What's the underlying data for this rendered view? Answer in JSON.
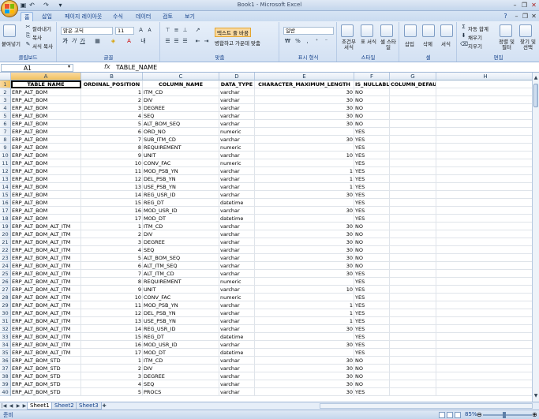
{
  "window": {
    "title": "Book1 - Microsoft Excel"
  },
  "quick_access": {
    "save_icon": "save-icon",
    "undo_icon": "undo-icon",
    "redo_icon": "redo-icon"
  },
  "tabs": [
    "홈",
    "삽입",
    "페이지 레이아웃",
    "수식",
    "데이터",
    "검토",
    "보기"
  ],
  "ribbon": {
    "clipboard": {
      "label": "클립보드",
      "paste": "붙여넣기",
      "cut": "잘라내기",
      "copy": "복사",
      "format_painter": "서식 복사"
    },
    "font": {
      "label": "글꼴",
      "font_name": "맑은 고딕",
      "font_size": "11",
      "bold": "가",
      "italic": "가",
      "underline": "가"
    },
    "alignment": {
      "label": "맞춤",
      "wrap_text": "텍스트 줄 바꿈",
      "merge_center": "병합하고 가운데 맞춤"
    },
    "number": {
      "label": "표시 형식",
      "format": "일반",
      "currency": "₩",
      "percent": "%"
    },
    "styles": {
      "label": "스타일",
      "conditional": "조건부 서식",
      "table_format": "표 서식",
      "cell_style": "셀 스타일"
    },
    "cells": {
      "label": "셀",
      "insert": "삽입",
      "delete": "삭제",
      "format": "서식"
    },
    "editing": {
      "label": "편집",
      "autosum": "자동 합계",
      "fill": "채우기",
      "clear": "지우기",
      "sort_filter": "정렬 및 필터",
      "find_select": "찾기 및 선택"
    }
  },
  "formula_bar": {
    "name_box": "A1",
    "fx": "fx",
    "content": "TABLE_NAME"
  },
  "grid": {
    "columns": [
      "A",
      "B",
      "C",
      "D",
      "E",
      "F",
      "G",
      "H"
    ],
    "header": [
      "TABLE_NAME",
      "ORDINAL_POSITION",
      "COLUMN_NAME",
      "DATA_TYPE",
      "CHARACTER_MAXIMUM_LENGTH",
      "IS_NULLABLE",
      "COLUMN_DEFAULT"
    ],
    "rows": [
      [
        "ERP_ALT_BOM",
        "1",
        "ITM_CD",
        "varchar",
        "30",
        "NO",
        ""
      ],
      [
        "ERP_ALT_BOM",
        "2",
        "DIV",
        "varchar",
        "30",
        "NO",
        ""
      ],
      [
        "ERP_ALT_BOM",
        "3",
        "DEGREE",
        "varchar",
        "30",
        "NO",
        ""
      ],
      [
        "ERP_ALT_BOM",
        "4",
        "SEQ",
        "varchar",
        "30",
        "NO",
        ""
      ],
      [
        "ERP_ALT_BOM",
        "5",
        "ALT_BOM_SEQ",
        "varchar",
        "30",
        "NO",
        ""
      ],
      [
        "ERP_ALT_BOM",
        "6",
        "ORD_NO",
        "numeric",
        "",
        "YES",
        ""
      ],
      [
        "ERP_ALT_BOM",
        "7",
        "SUB_ITM_CD",
        "varchar",
        "30",
        "YES",
        ""
      ],
      [
        "ERP_ALT_BOM",
        "8",
        "REQUIREMENT",
        "numeric",
        "",
        "YES",
        ""
      ],
      [
        "ERP_ALT_BOM",
        "9",
        "UNIT",
        "varchar",
        "10",
        "YES",
        ""
      ],
      [
        "ERP_ALT_BOM",
        "10",
        "CONV_FAC",
        "numeric",
        "",
        "YES",
        ""
      ],
      [
        "ERP_ALT_BOM",
        "11",
        "MOD_PSB_YN",
        "varchar",
        "1",
        "YES",
        ""
      ],
      [
        "ERP_ALT_BOM",
        "12",
        "DEL_PSB_YN",
        "varchar",
        "1",
        "YES",
        ""
      ],
      [
        "ERP_ALT_BOM",
        "13",
        "USE_PSB_YN",
        "varchar",
        "1",
        "YES",
        ""
      ],
      [
        "ERP_ALT_BOM",
        "14",
        "REG_USR_ID",
        "varchar",
        "30",
        "YES",
        ""
      ],
      [
        "ERP_ALT_BOM",
        "15",
        "REG_DT",
        "datetime",
        "",
        "YES",
        ""
      ],
      [
        "ERP_ALT_BOM",
        "16",
        "MOD_USR_ID",
        "varchar",
        "30",
        "YES",
        ""
      ],
      [
        "ERP_ALT_BOM",
        "17",
        "MOD_DT",
        "datetime",
        "",
        "YES",
        ""
      ],
      [
        "ERP_ALT_BOM_ALT_ITM",
        "1",
        "ITM_CD",
        "varchar",
        "30",
        "NO",
        ""
      ],
      [
        "ERP_ALT_BOM_ALT_ITM",
        "2",
        "DIV",
        "varchar",
        "30",
        "NO",
        ""
      ],
      [
        "ERP_ALT_BOM_ALT_ITM",
        "3",
        "DEGREE",
        "varchar",
        "30",
        "NO",
        ""
      ],
      [
        "ERP_ALT_BOM_ALT_ITM",
        "4",
        "SEQ",
        "varchar",
        "30",
        "NO",
        ""
      ],
      [
        "ERP_ALT_BOM_ALT_ITM",
        "5",
        "ALT_BOM_SEQ",
        "varchar",
        "30",
        "NO",
        ""
      ],
      [
        "ERP_ALT_BOM_ALT_ITM",
        "6",
        "ALT_ITM_SEQ",
        "varchar",
        "30",
        "NO",
        ""
      ],
      [
        "ERP_ALT_BOM_ALT_ITM",
        "7",
        "ALT_ITM_CD",
        "varchar",
        "30",
        "YES",
        ""
      ],
      [
        "ERP_ALT_BOM_ALT_ITM",
        "8",
        "REQUIREMENT",
        "numeric",
        "",
        "YES",
        ""
      ],
      [
        "ERP_ALT_BOM_ALT_ITM",
        "9",
        "UNIT",
        "varchar",
        "10",
        "YES",
        ""
      ],
      [
        "ERP_ALT_BOM_ALT_ITM",
        "10",
        "CONV_FAC",
        "numeric",
        "",
        "YES",
        ""
      ],
      [
        "ERP_ALT_BOM_ALT_ITM",
        "11",
        "MOD_PSB_YN",
        "varchar",
        "1",
        "YES",
        ""
      ],
      [
        "ERP_ALT_BOM_ALT_ITM",
        "12",
        "DEL_PSB_YN",
        "varchar",
        "1",
        "YES",
        ""
      ],
      [
        "ERP_ALT_BOM_ALT_ITM",
        "13",
        "USE_PSB_YN",
        "varchar",
        "1",
        "YES",
        ""
      ],
      [
        "ERP_ALT_BOM_ALT_ITM",
        "14",
        "REG_USR_ID",
        "varchar",
        "30",
        "YES",
        ""
      ],
      [
        "ERP_ALT_BOM_ALT_ITM",
        "15",
        "REG_DT",
        "datetime",
        "",
        "YES",
        ""
      ],
      [
        "ERP_ALT_BOM_ALT_ITM",
        "16",
        "MOD_USR_ID",
        "varchar",
        "30",
        "YES",
        ""
      ],
      [
        "ERP_ALT_BOM_ALT_ITM",
        "17",
        "MOD_DT",
        "datetime",
        "",
        "YES",
        ""
      ],
      [
        "ERP_ALT_BOM_STD",
        "1",
        "ITM_CD",
        "varchar",
        "30",
        "NO",
        ""
      ],
      [
        "ERP_ALT_BOM_STD",
        "2",
        "DIV",
        "varchar",
        "30",
        "NO",
        ""
      ],
      [
        "ERP_ALT_BOM_STD",
        "3",
        "DEGREE",
        "varchar",
        "30",
        "NO",
        ""
      ],
      [
        "ERP_ALT_BOM_STD",
        "4",
        "SEQ",
        "varchar",
        "30",
        "NO",
        ""
      ],
      [
        "ERP_ALT_BOM_STD",
        "5",
        "PROCS",
        "varchar",
        "30",
        "YES",
        ""
      ]
    ]
  },
  "sheets": [
    "Sheet1",
    "Sheet2",
    "Sheet3"
  ],
  "status": {
    "text": "준비",
    "zoom": "85%"
  },
  "colors": {
    "selected_header": "#f1c15f",
    "ribbon_text": "#15428b",
    "gridline": "#dfe4ea"
  }
}
